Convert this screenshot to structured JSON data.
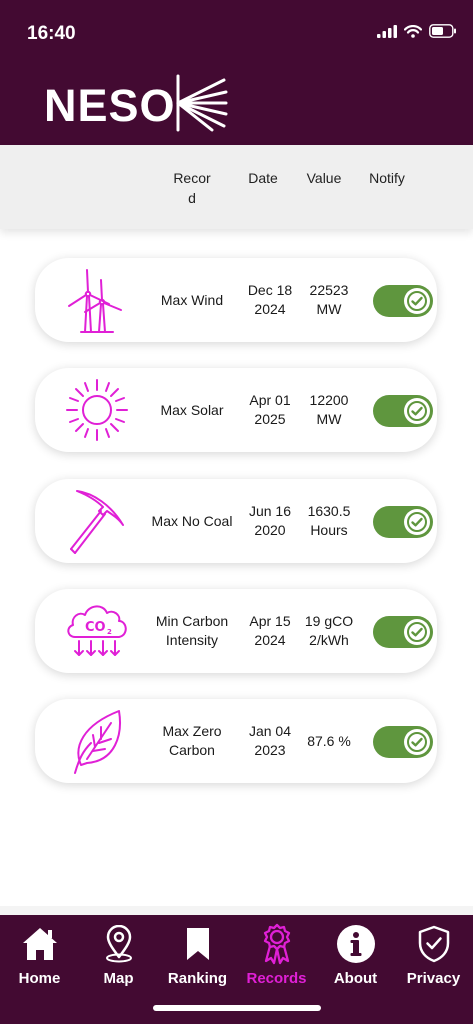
{
  "status_bar": {
    "time": "16:40"
  },
  "header": {
    "logo_text": "NESO"
  },
  "columns": {
    "record": "Recor d",
    "date": "Date",
    "value": "Value",
    "notify": "Notify"
  },
  "records": [
    {
      "name": "Max Wind",
      "date": "Dec 18 2024",
      "value": "22523 MW",
      "icon": "wind-turbine-icon",
      "notify": true
    },
    {
      "name": "Max Solar",
      "date": "Apr 01 2025",
      "value": "12200 MW",
      "icon": "sun-icon",
      "notify": true
    },
    {
      "name": "Max No Coal",
      "date": "Jun 16 2020",
      "value": "1630.5 Hours",
      "icon": "pickaxe-icon",
      "notify": true
    },
    {
      "name": "Min Carbon Intensity",
      "date": "Apr 15 2024",
      "value": "19 gCO2/kWh",
      "icon": "co2-cloud-icon",
      "notify": true
    },
    {
      "name": "Max Zero Carbon",
      "date": "Jan 04 2023",
      "value": "87.6 %",
      "icon": "leaf-icon",
      "notify": true
    }
  ],
  "nav": {
    "items": [
      {
        "label": "Home",
        "icon": "home-icon"
      },
      {
        "label": "Map",
        "icon": "map-pin-icon"
      },
      {
        "label": "Ranking",
        "icon": "bookmark-icon"
      },
      {
        "label": "Records",
        "icon": "award-ribbon-icon",
        "active": true
      },
      {
        "label": "About",
        "icon": "info-icon"
      },
      {
        "label": "Privacy",
        "icon": "shield-check-icon"
      }
    ]
  },
  "colors": {
    "brand": "#430a32",
    "accent": "#e020d6",
    "toggle_on": "#5f963e"
  }
}
